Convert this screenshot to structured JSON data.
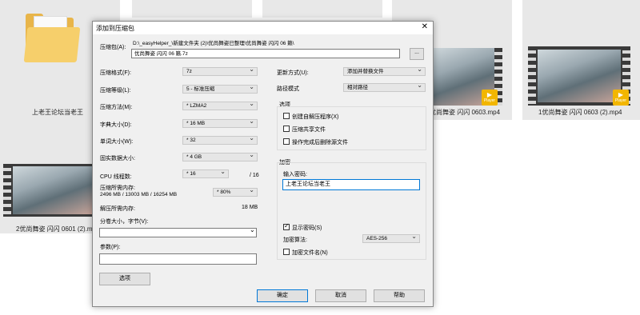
{
  "explorer": {
    "folder_label": "上老王论坛当老王",
    "right_video_label": "1优尚舞姿 闪闪 0603 (2).mp4",
    "mid_video_label": "优尚舞姿 闪闪 0603.mp4",
    "left_video_label": "2优尚舞姿 闪闪 0601 (2).mp4",
    "badge_text": "Player"
  },
  "dialog": {
    "title": "添加到压缩包",
    "close_glyph": "✕",
    "archive_label": "压缩包(A):",
    "archive_path": "D:\\_easyHelper_\\新建文件夹 (2)\\优尚舞姿已整理\\优尚舞姿 闪闪 06 籁\\",
    "archive_name": "优尚舞姿 闪闪 06 籁.7z",
    "browse_label": "...",
    "format_label": "压缩格式(F):",
    "format_value": "7z",
    "level_label": "压缩等级(L):",
    "level_value": "5 - 标准压缩",
    "method_label": "压缩方法(M):",
    "method_value": "* LZMA2",
    "dict_label": "字典大小(D):",
    "dict_value": "* 16 MB",
    "word_label": "单词大小(W):",
    "word_value": "* 32",
    "solid_label": "固实数据大小:",
    "solid_value": "* 4 GB",
    "threads_label": "CPU 线程数:",
    "threads_value": "* 16",
    "threads_total": "/ 16",
    "mem_comp_label": "压缩所需内存:",
    "mem_comp_value": "2496 MB / 13003 MB / 16254 MB",
    "mem_percent": "* 80%",
    "mem_decomp_label": "解压所需内存:",
    "mem_decomp_value": "18 MB",
    "split_label": "分卷大小，字节(V):",
    "split_value": "",
    "params_label": "参数(P):",
    "params_value": "",
    "options_button": "选项",
    "update_label": "更新方式(U):",
    "update_value": "添加并替换文件",
    "path_label": "路径模式",
    "path_value": "相对路径",
    "options_group": "选项",
    "opt_sfx": "创建自解压程序(X)",
    "opt_shared": "压缩共享文件",
    "opt_delete": "操作完成后删除源文件",
    "encrypt_group": "加密",
    "password_label": "输入密码:",
    "password_value": "上老王论坛当老王",
    "show_password": "显示密码(S)",
    "enc_method_label": "加密算法:",
    "enc_method_value": "AES-256",
    "encrypt_names": "加密文件名(N)",
    "ok": "确定",
    "cancel": "取消",
    "help": "帮助"
  }
}
